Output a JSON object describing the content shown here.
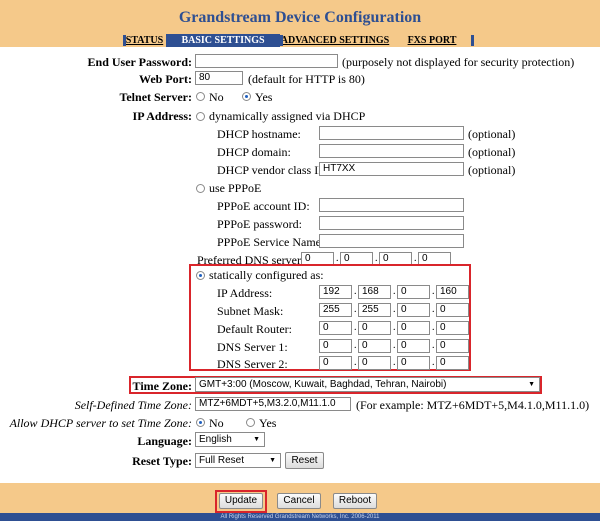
{
  "app": {
    "title": "Grandstream Device Configuration"
  },
  "tabs": [
    "STATUS",
    "BASIC SETTINGS",
    "ADVANCED SETTINGS",
    "FXS PORT"
  ],
  "colors": {
    "accent": "#2e4f92",
    "header_bg": "#f5c98a",
    "highlight": "#d9252b"
  },
  "form": {
    "end_user_password": {
      "label": "End User Password:",
      "value": "",
      "note": "(purposely not displayed for security protection)"
    },
    "web_port": {
      "label": "Web Port:",
      "value": "80",
      "note": "(default for HTTP is 80)"
    },
    "telnet": {
      "label": "Telnet Server:",
      "options": [
        "No",
        "Yes"
      ],
      "selected": "Yes"
    },
    "ip_address": {
      "label": "IP Address:",
      "dhcp": {
        "label": "dynamically assigned via DHCP",
        "hostname": {
          "label": "DHCP hostname:",
          "value": "",
          "note": "(optional)"
        },
        "domain": {
          "label": "DHCP domain:",
          "value": "",
          "note": "(optional)"
        },
        "vendor": {
          "label": "DHCP vendor class ID:",
          "value": "HT7XX",
          "note": "(optional)"
        }
      },
      "pppoe": {
        "label": "use PPPoE",
        "account": {
          "label": "PPPoE account ID:",
          "value": ""
        },
        "password": {
          "label": "PPPoE password:",
          "value": ""
        },
        "service": {
          "label": "PPPoE Service Name:",
          "value": ""
        }
      },
      "preferred_dns": {
        "label": "Preferred DNS server:",
        "octets": [
          "0",
          "0",
          "0",
          "0"
        ]
      },
      "static": {
        "label": "statically configured as:",
        "selected": true,
        "ip": {
          "label": "IP Address:",
          "octets": [
            "192",
            "168",
            "0",
            "160"
          ]
        },
        "mask": {
          "label": "Subnet Mask:",
          "octets": [
            "255",
            "255",
            "0",
            "0"
          ]
        },
        "router": {
          "label": "Default Router:",
          "octets": [
            "0",
            "0",
            "0",
            "0"
          ]
        },
        "dns1": {
          "label": "DNS Server 1:",
          "octets": [
            "0",
            "0",
            "0",
            "0"
          ]
        },
        "dns2": {
          "label": "DNS Server 2:",
          "octets": [
            "0",
            "0",
            "0",
            "0"
          ]
        }
      }
    },
    "time_zone": {
      "label": "Time Zone:",
      "value": "GMT+3:00 (Moscow, Kuwait, Baghdad, Tehran, Nairobi)"
    },
    "self_tz": {
      "label": "Self-Defined Time Zone:",
      "value": "MTZ+6MDT+5,M3.2.0,M11.1.0",
      "note": "(For example: MTZ+6MDT+5,M4.1.0,M11.1.0)"
    },
    "allow_dhcp_tz": {
      "label": "Allow DHCP server to set Time Zone:",
      "options": [
        "No",
        "Yes"
      ],
      "selected": "No"
    },
    "language": {
      "label": "Language:",
      "value": "English"
    },
    "reset": {
      "label": "Reset Type:",
      "value": "Full Reset",
      "button": "Reset"
    }
  },
  "buttons": {
    "update": "Update",
    "cancel": "Cancel",
    "reboot": "Reboot"
  },
  "footer": {
    "copyright": "All Rights Reserved Grandstream Networks, Inc. 2006-2011"
  }
}
